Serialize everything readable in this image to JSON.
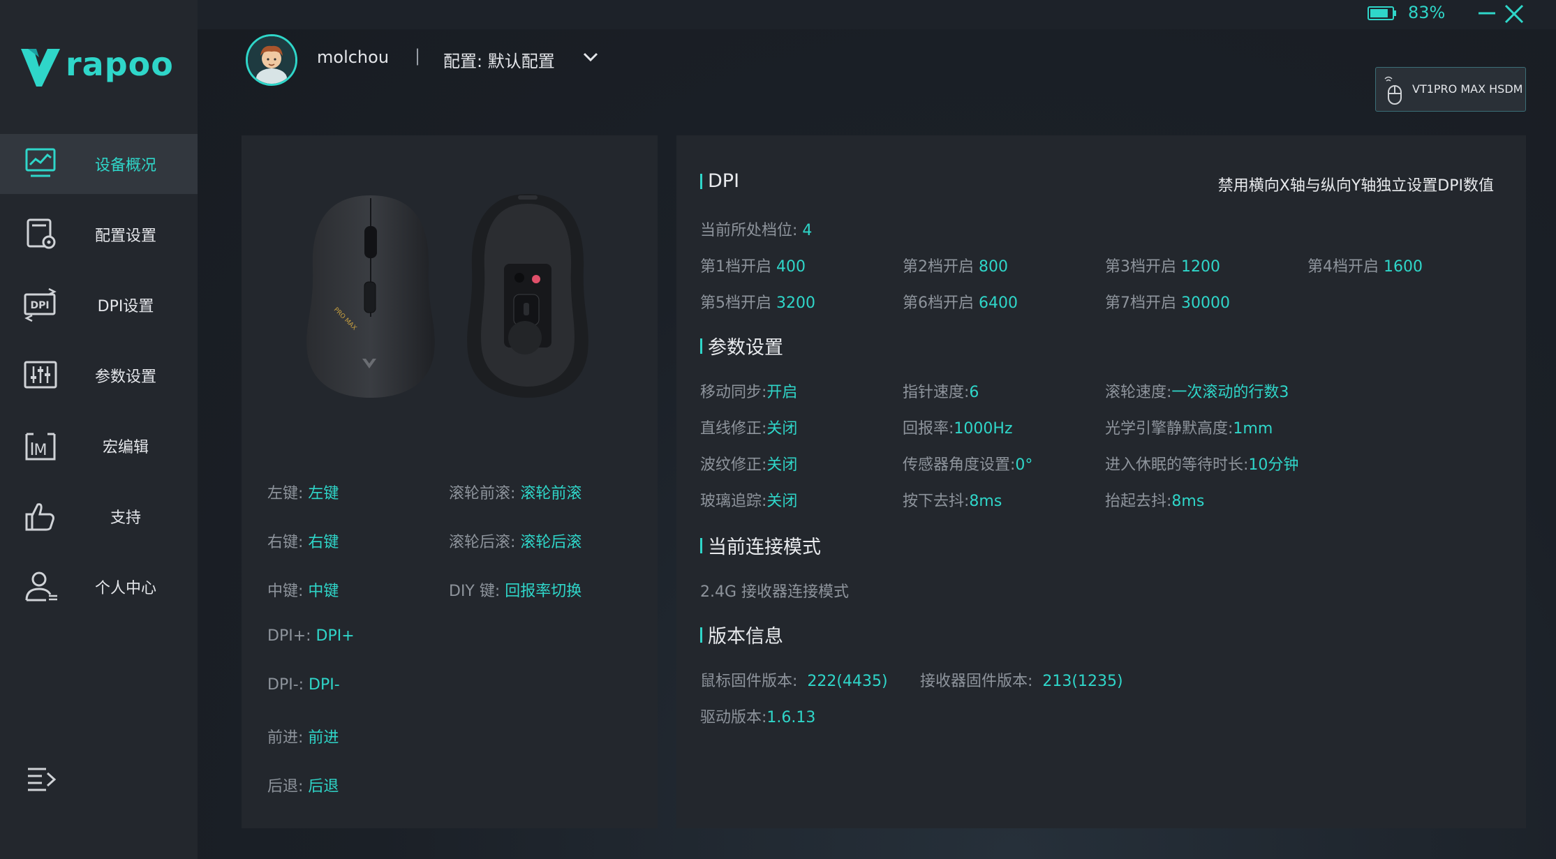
{
  "app": {
    "brand": "rapoo"
  },
  "topbar": {
    "battery_percent": "83%",
    "battery_level": 0.83
  },
  "header": {
    "username": "molchou",
    "separator": "|",
    "profile_label": "配置: 默认配置",
    "device_name": "VT1PRO MAX HSDM"
  },
  "nav": [
    {
      "label": "设备概况",
      "icon": "monitor-chart-icon",
      "active": true
    },
    {
      "label": "配置设置",
      "icon": "config-gear-icon",
      "active": false
    },
    {
      "label": "DPI设置",
      "icon": "dpi-icon",
      "active": false
    },
    {
      "label": "参数设置",
      "icon": "sliders-icon",
      "active": false
    },
    {
      "label": "宏编辑",
      "icon": "macro-icon",
      "active": false
    },
    {
      "label": "支持",
      "icon": "thumbs-up-icon",
      "active": false
    },
    {
      "label": "个人中心",
      "icon": "user-icon",
      "active": false
    }
  ],
  "buttons": [
    {
      "k": "左键:",
      "v": "左键"
    },
    {
      "k": "右键:",
      "v": "右键"
    },
    {
      "k": "中键:",
      "v": "中键"
    },
    {
      "k": "DPI+:",
      "v": "DPI+"
    },
    {
      "k": "DPI-:",
      "v": "DPI-"
    },
    {
      "k": "前进:",
      "v": "前进"
    },
    {
      "k": "后退:",
      "v": "后退"
    },
    {
      "k": "滚轮前滚:",
      "v": "滚轮前滚"
    },
    {
      "k": "滚轮后滚:",
      "v": "滚轮后滚"
    },
    {
      "k": "DIY 键:",
      "v": "回报率切换"
    }
  ],
  "mouse": {
    "badge": "PRO MAX"
  },
  "dpi": {
    "title": "DPI",
    "note": "禁用横向X轴与纵向Y轴独立设置DPI数值",
    "current": {
      "k": "当前所处档位:",
      "v": "4"
    },
    "levels": [
      {
        "k": "第1档开启",
        "v": "400"
      },
      {
        "k": "第2档开启",
        "v": "800"
      },
      {
        "k": "第3档开启",
        "v": "1200"
      },
      {
        "k": "第4档开启",
        "v": "1600"
      },
      {
        "k": "第5档开启",
        "v": "3200"
      },
      {
        "k": "第6档开启",
        "v": "6400"
      },
      {
        "k": "第7档开启",
        "v": "30000"
      }
    ]
  },
  "params": {
    "title": "参数设置",
    "items": [
      {
        "k": "移动同步:",
        "v": "开启"
      },
      {
        "k": "指针速度:",
        "v": "6"
      },
      {
        "k": "滚轮速度:",
        "v": "一次滚动的行数3"
      },
      {
        "k": "直线修正:",
        "v": "关闭"
      },
      {
        "k": "回报率:",
        "v": "1000Hz"
      },
      {
        "k": "光学引擎静默高度:",
        "v": "1mm"
      },
      {
        "k": "波纹修正:",
        "v": "关闭"
      },
      {
        "k": "传感器角度设置:",
        "v": "0°"
      },
      {
        "k": "进入休眠的等待时长:",
        "v": "10分钟"
      },
      {
        "k": "玻璃追踪:",
        "v": "关闭"
      },
      {
        "k": "按下去抖:",
        "v": "8ms"
      },
      {
        "k": "抬起去抖:",
        "v": "8ms"
      }
    ]
  },
  "connection": {
    "title": "当前连接模式",
    "value": "2.4G 接收器连接模式"
  },
  "version": {
    "title": "版本信息",
    "mouse_fw": {
      "k": "鼠标固件版本:",
      "v": "222(4435)"
    },
    "receiver_fw": {
      "k": "接收器固件版本:",
      "v": "213(1235)"
    },
    "driver": {
      "k": "驱动版本:",
      "v": "1.6.13"
    }
  },
  "colors": {
    "accent": "#2fd6c9",
    "sidebar": "#23272d",
    "panel": "#23272d"
  }
}
